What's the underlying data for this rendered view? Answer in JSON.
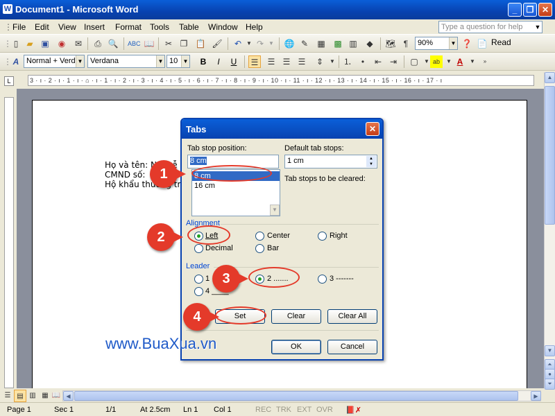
{
  "app": {
    "title": "Document1 - Microsoft Word",
    "icon": "W"
  },
  "menu": {
    "items": [
      "File",
      "Edit",
      "View",
      "Insert",
      "Format",
      "Tools",
      "Table",
      "Window",
      "Help"
    ],
    "help_placeholder": "Type a question for help"
  },
  "toolbar": {
    "zoom": "90%",
    "read_label": "Read"
  },
  "format_toolbar": {
    "style": "Normal + Verda",
    "font": "Verdana",
    "size": "10",
    "bold": "B",
    "italic": "I",
    "underline": "U"
  },
  "ruler": {
    "marks": "3 · ı · 2 · ı · 1 · ı · ⌂ · ı · 1 · ı · 2 · ı · 3 · ı · 4 · ı · 5 · ı · 6 · ı · 7 · ı · 8 · ı · 9 · ı · 10 · ı · 11 · ı · 12 · ı · 13 · ı · 14 · ı · 15 · ı · 16 · ı · 17 · ı"
  },
  "document": {
    "lines": [
      "Họ và tên: Nguyễ",
      "CMND số:",
      "Hộ khẩu thường trú"
    ]
  },
  "dialog": {
    "title": "Tabs",
    "tab_stop_label": "Tab stop position:",
    "tab_stop_value": "8 cm",
    "tab_stops": [
      "8 cm",
      "16 cm"
    ],
    "default_label": "Default tab stops:",
    "default_value": "1 cm",
    "cleared_label": "Tab stops to be cleared:",
    "alignment_label": "Alignment",
    "alignment": {
      "left": "Left",
      "center": "Center",
      "right": "Right",
      "decimal": "Decimal",
      "bar": "Bar"
    },
    "leader_label": "Leader",
    "leader": {
      "l1": "1",
      "l2": "2 .......",
      "l3": "3 -------",
      "l4": "4 ____"
    },
    "buttons": {
      "set": "Set",
      "clear": "Clear",
      "clear_all": "Clear All",
      "ok": "OK",
      "cancel": "Cancel"
    }
  },
  "annotations": {
    "markers": [
      "1",
      "2",
      "3",
      "4"
    ],
    "watermark": "www.BuaXua.vn",
    "color": "#e43a2a"
  },
  "status": {
    "page": "Page 1",
    "sec": "Sec 1",
    "pages": "1/1",
    "at": "At 2.5cm",
    "ln": "Ln 1",
    "col": "Col 1",
    "rec": "REC",
    "trk": "TRK",
    "ext": "EXT",
    "ovr": "OVR"
  }
}
